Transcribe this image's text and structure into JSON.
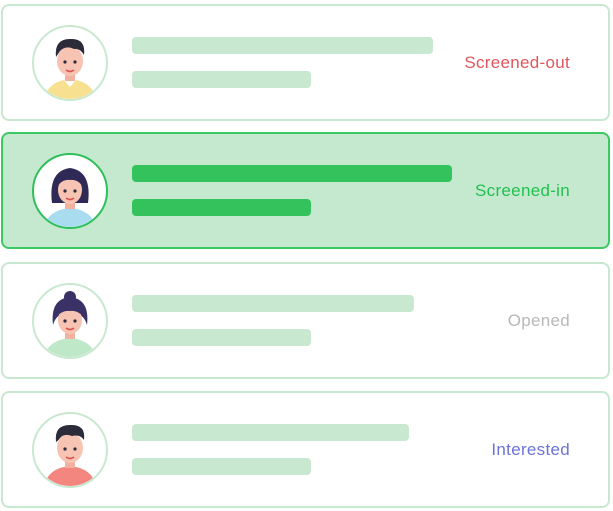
{
  "candidates": [
    {
      "status": "Screened-out",
      "status_color": "#e0575b",
      "selected": false,
      "avatar": "male-candidate-avatar-yellow-shirt",
      "line_fill": [
        0.64,
        0.38
      ]
    },
    {
      "status": "Screened-in",
      "status_color": "#22c04f",
      "selected": true,
      "avatar": "female-candidate-avatar-blue-shirt",
      "line_fill": [
        0.68,
        0.38
      ]
    },
    {
      "status": "Opened",
      "status_color": "#b8b8b8",
      "selected": false,
      "avatar": "female-candidate-avatar-green-shirt",
      "line_fill": [
        0.6,
        0.38
      ]
    },
    {
      "status": "Interested",
      "status_color": "#6c72d9",
      "selected": false,
      "avatar": "male-candidate-avatar-red-shirt",
      "line_fill": [
        0.59,
        0.38
      ]
    }
  ],
  "colors": {
    "card_border": "#c8e8cf",
    "selected_bg": "#c5e9cf",
    "selected_border": "#3cc863",
    "placeholder_line": "#c8e8cf",
    "placeholder_line_selected": "#33c25c"
  }
}
